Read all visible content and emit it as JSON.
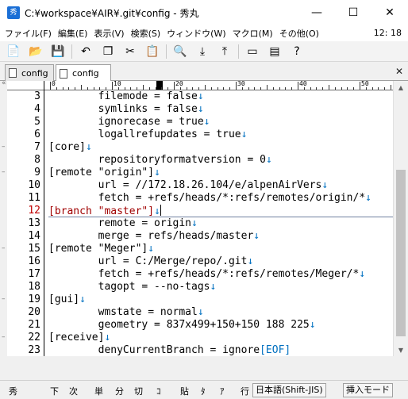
{
  "window": {
    "title": "C:¥workspace¥AIR¥.git¥config - 秀丸",
    "app_icon": "hidemaru-icon",
    "minimize": "—",
    "maximize": "☐",
    "close": "✕"
  },
  "menu": {
    "items": [
      "ファイル(F)",
      "編集(E)",
      "表示(V)",
      "検索(S)",
      "ウィンドウ(W)",
      "マクロ(M)",
      "その他(O)"
    ],
    "clock": "12: 18"
  },
  "toolbar": {
    "buttons": [
      {
        "icon": "new-file-icon",
        "glyph": "📄"
      },
      {
        "icon": "open-folder-icon",
        "glyph": "📂"
      },
      {
        "icon": "save-icon",
        "glyph": "💾"
      },
      {
        "icon": "undo-icon",
        "glyph": "↶"
      },
      {
        "icon": "copy-icon",
        "glyph": "❐"
      },
      {
        "icon": "cut-icon",
        "glyph": "✂"
      },
      {
        "icon": "paste-icon",
        "glyph": "📋"
      },
      {
        "icon": "search-icon",
        "glyph": "🔍"
      },
      {
        "icon": "search-down-icon",
        "glyph": "⤓"
      },
      {
        "icon": "search-up-icon",
        "glyph": "⤒"
      },
      {
        "icon": "window-icon",
        "glyph": "▭"
      },
      {
        "icon": "split-window-icon",
        "glyph": "▤"
      },
      {
        "icon": "help-icon",
        "glyph": "?"
      }
    ]
  },
  "tabs": [
    {
      "label": "config",
      "active": false
    },
    {
      "label": "config",
      "active": true
    }
  ],
  "tab_close": "✕",
  "ruler": {
    "numbers": [
      "0",
      "10",
      "20",
      "30",
      "40",
      "50"
    ]
  },
  "editor": {
    "current_line": 12,
    "lines": [
      {
        "n": "3",
        "text": "        filemode = false",
        "nl": "↓"
      },
      {
        "n": "4",
        "text": "        symlinks = false",
        "nl": "↓"
      },
      {
        "n": "5",
        "text": "        ignorecase = true",
        "nl": "↓"
      },
      {
        "n": "6",
        "text": "        logallrefupdates = true",
        "nl": "↓"
      },
      {
        "n": "7",
        "text": "[core]",
        "nl": "↓"
      },
      {
        "n": "8",
        "text": "        repositoryformatversion = 0",
        "nl": "↓"
      },
      {
        "n": "9",
        "text": "[remote \"origin\"]",
        "nl": "↓"
      },
      {
        "n": "10",
        "text": "        url = //172.18.26.104/e/alpenAirVers",
        "nl": "↓"
      },
      {
        "n": "11",
        "text": "        fetch = +refs/heads/*:refs/remotes/origin/*",
        "nl": "↓"
      },
      {
        "n": "12",
        "text": "[branch \"master\"]",
        "nl": "↓"
      },
      {
        "n": "13",
        "text": "        remote = origin",
        "nl": "↓"
      },
      {
        "n": "14",
        "text": "        merge = refs/heads/master",
        "nl": "↓"
      },
      {
        "n": "15",
        "text": "[remote \"Meger\"]",
        "nl": "↓"
      },
      {
        "n": "16",
        "text": "        url = C:/Merge/repo/.git",
        "nl": "↓"
      },
      {
        "n": "17",
        "text": "        fetch = +refs/heads/*:refs/remotes/Meger/*",
        "nl": "↓"
      },
      {
        "n": "18",
        "text": "        tagopt = --no-tags",
        "nl": "↓"
      },
      {
        "n": "19",
        "text": "[gui]",
        "nl": "↓"
      },
      {
        "n": "20",
        "text": "        wmstate = normal",
        "nl": "↓"
      },
      {
        "n": "21",
        "text": "        geometry = 837x499+150+150 188 225",
        "nl": "↓"
      },
      {
        "n": "22",
        "text": "[receive]",
        "nl": "↓"
      },
      {
        "n": "23",
        "text": "        denyCurrentBranch = ignore",
        "nl": "[EOF]"
      }
    ]
  },
  "fold_markers": [
    {
      "line": 7,
      "glyph": "–"
    },
    {
      "line": 9,
      "glyph": "–"
    },
    {
      "line": 15,
      "glyph": "–"
    },
    {
      "line": 19,
      "glyph": "–"
    },
    {
      "line": 22,
      "glyph": "–"
    }
  ],
  "statusbar": {
    "fn_keys": [
      "秀",
      "下",
      "次",
      "単",
      "分",
      "切",
      "ｺ",
      "貼",
      "ﾀ",
      "ｱ",
      "行"
    ],
    "encoding": "日本語(Shift-JIS)",
    "insert_mode": "挿入モード"
  },
  "colors": {
    "newline_marker": "#0070c0",
    "current_line_number": "#c00000",
    "current_line_text": "#a00000"
  }
}
